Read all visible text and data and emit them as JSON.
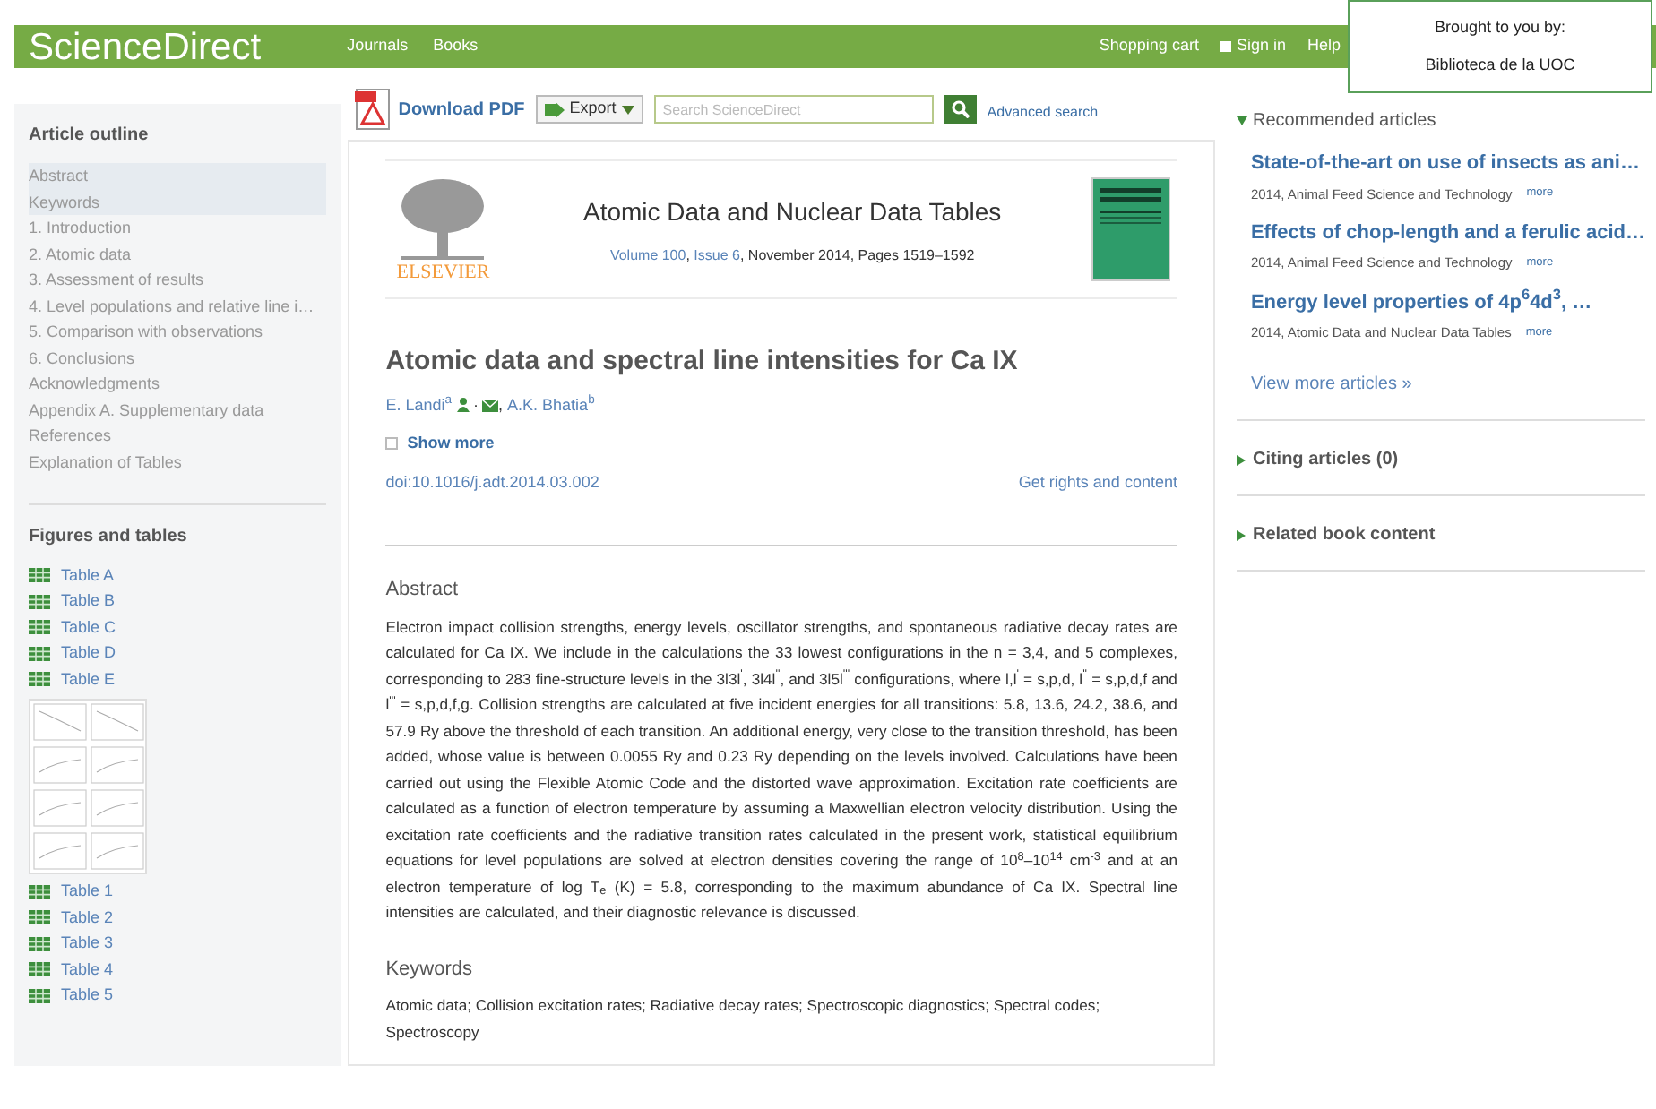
{
  "header": {
    "logo": "ScienceDirect",
    "nav": [
      "Journals",
      "Books"
    ],
    "links": [
      "Shopping cart",
      "Sign in",
      "Help"
    ],
    "access_box": [
      "Brought to you by:",
      "Biblioteca de la UOC"
    ]
  },
  "toolbar": {
    "download": "Download PDF",
    "export": "Export",
    "search": {
      "placeholder": "Search ScienceDirect"
    },
    "advanced": "Advanced search"
  },
  "outline": {
    "title": "Article outline",
    "items": [
      {
        "label": "Abstract",
        "selected": true
      },
      {
        "label": "Keywords",
        "selected": true
      },
      {
        "label": "1. Introduction",
        "selected": false
      },
      {
        "label": "2. Atomic data",
        "selected": false
      },
      {
        "label": "3. Assessment of results",
        "selected": false
      },
      {
        "label": "4. Level populations and relative line i…",
        "selected": false
      },
      {
        "label": "5. Comparison with observations",
        "selected": false
      },
      {
        "label": "6. Conclusions",
        "selected": false
      },
      {
        "label": "Acknowledgments",
        "selected": false
      },
      {
        "label": "Appendix A. Supplementary data",
        "selected": false
      },
      {
        "label": "References",
        "selected": false
      },
      {
        "label": "Explanation of Tables",
        "selected": false
      }
    ]
  },
  "figures": {
    "title": "Figures and tables",
    "items": [
      {
        "kind": "table",
        "label": "Table A"
      },
      {
        "kind": "table",
        "label": "Table B"
      },
      {
        "kind": "table",
        "label": "Table C"
      },
      {
        "kind": "table",
        "label": "Table D"
      },
      {
        "kind": "table",
        "label": "Table E"
      },
      {
        "kind": "figure"
      },
      {
        "kind": "table",
        "label": "Table 1"
      },
      {
        "kind": "table",
        "label": "Table 2"
      },
      {
        "kind": "table",
        "label": "Table 3"
      },
      {
        "kind": "table",
        "label": "Table 4"
      },
      {
        "kind": "table",
        "label": "Table 5"
      }
    ]
  },
  "article": {
    "publisher": "ELSEVIER",
    "journal": "Atomic Data and Nuclear Data Tables",
    "volume": "Volume 100",
    "volume_separator": ", ",
    "issue": "Issue 6",
    "date": ", November 2014, Pages 1519–1592",
    "title": "Atomic data and spectral line intensities for Ca IX",
    "authors": [
      {
        "name": "E. Landi",
        "affiliation": "a",
        "corresponding": true,
        "icon_separator": "·"
      },
      {
        "separator": ", ",
        "name": "A.K. Bhatia",
        "affiliation": "b",
        "corresponding": false
      }
    ],
    "show_more": "Show more",
    "doi": "doi:10.1016/j.adt.2014.03.002",
    "rights": "Get rights and content",
    "abstract_heading": "Abstract",
    "abstract": "Electron impact collision strengths, energy levels, oscillator strengths, and spontaneous radiative decay rates are calculated for Ca IX. We include in the calculations the 33 lowest configurations in the n = 3,4, and 5 complexes, corresponding to 283 fine-structure levels in the 3l3l$^{'}$, 3l4l$^{''}$, and 3l5l$^{'''}$ configurations, where l,l$^{'}$ = s,p,d, l$^{''}$ = s,p,d,f and l$^{'''}$ = s,p,d,f,g. Collision strengths are calculated at five incident energies for all transitions: 5.8, 13.6, 24.2, 38.6, and 57.9 Ry above the threshold of each transition. An additional energy, very close to the transition threshold, has been added, whose value is between 0.0055 Ry and 0.23 Ry depending on the levels involved. Calculations have been carried out using the Flexible Atomic Code and the distorted wave approximation. Excitation rate coefficients are calculated as a function of electron temperature by assuming a Maxwellian electron velocity distribution. Using the excitation rate coefficients and the radiative transition rates calculated in the present work, statistical equilibrium equations for level populations are solved at electron densities covering the range of 10$^{8}$–10$^{14}$ cm$^{-3}$ and at an electron temperature of log T$_{e}$ (K) = 5.8, corresponding to the maximum abundance of Ca IX. Spectral line intensities are calculated, and their diagnostic relevance is discussed.",
    "keywords_heading": "Keywords",
    "keywords": "Atomic data; Collision excitation rates; Radiative decay rates; Spectroscopic diagnostics; Spectral codes; Spectroscopy"
  },
  "sidebar": {
    "recommended": {
      "title": "Recommended articles",
      "expanded": true,
      "items": [
        {
          "title": "State-of-the-art on use of insects as ani…",
          "source": "2014, Animal Feed Science and Technology",
          "more": "more"
        },
        {
          "title": "Effects of chop-length and a ferulic acid…",
          "source": "2014, Animal Feed Science and Technology",
          "more": "more"
        },
        {
          "title": "Energy level properties of 4p$^{6}$4d$^{3}$, …",
          "source": "2014, Atomic Data and Nuclear Data Tables",
          "more": "more"
        }
      ],
      "view_more": "View more articles »"
    },
    "sections": [
      {
        "title": "Citing articles (0)",
        "expanded": false
      },
      {
        "title": "Related book content",
        "expanded": false
      }
    ]
  }
}
